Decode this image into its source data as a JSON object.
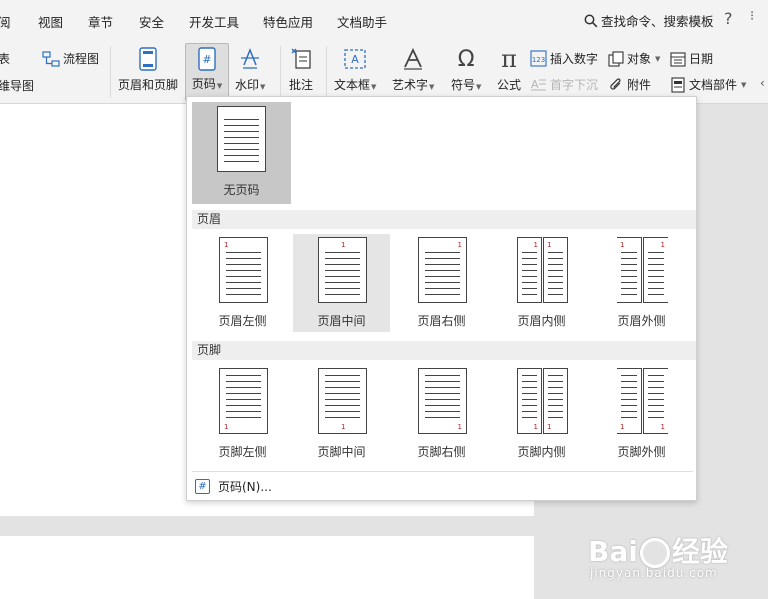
{
  "menubar": {
    "items": [
      "阅",
      "视图",
      "章节",
      "安全",
      "开发工具",
      "特色应用",
      "文档助手"
    ],
    "search_label": "查找命令、搜索模板",
    "help": "?",
    "more": "⁝"
  },
  "ribbon": {
    "table_label": "表",
    "flowchart_label": "流程图",
    "mindmap_label": "维导图",
    "header_footer_label": "页眉和页脚",
    "page_number_label": "页码",
    "watermark_label": "水印",
    "comment_label": "批注",
    "textbox_label": "文本框",
    "wordart_label": "艺术字",
    "symbol_label": "符号",
    "formula_label": "公式",
    "insert_number_label": "插入数字",
    "drop_cap_label": "首字下沉",
    "object_label": "对象",
    "attachment_label": "附件",
    "date_label": "日期",
    "doc_parts_label": "文档部件",
    "more_label": "‹"
  },
  "dropdown": {
    "no_number_label": "无页码",
    "header_section_label": "页眉",
    "footer_section_label": "页脚",
    "header_options": [
      "页眉左侧",
      "页眉中间",
      "页眉右侧",
      "页眉内侧",
      "页眉外侧"
    ],
    "footer_options": [
      "页脚左侧",
      "页脚中间",
      "页脚右侧",
      "页脚内侧",
      "页脚外侧"
    ],
    "page_number_dialog_label": "页码(N)...",
    "page_num_glyph": "1"
  },
  "watermark": {
    "logo_text_left": "Bai",
    "logo_text_right": "经验",
    "url": "jingyan.baidu.com"
  },
  "colors": {
    "accent_blue": "#2f6fc0",
    "page_number_red": "#b32020"
  }
}
